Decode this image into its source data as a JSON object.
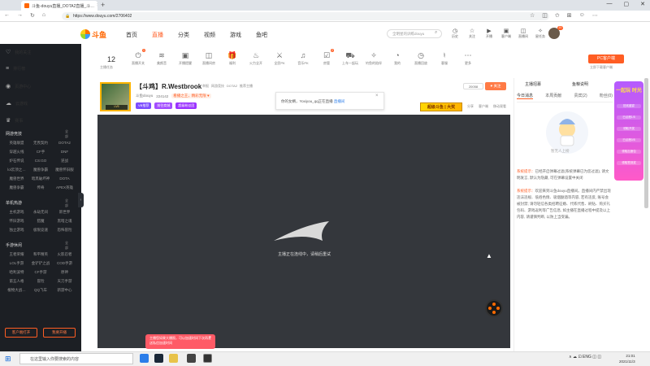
{
  "browser": {
    "tab_title": "斗鱼-douyu直播_DOTA2直播_斗…",
    "url": "https://www.douyu.com/2706402"
  },
  "site": {
    "logo_text": "斗鱼",
    "nav": [
      "首页",
      "直播",
      "分类",
      "视频",
      "游戏",
      "鱼吧"
    ],
    "nav_active": 1,
    "search_placeholder": "全明星的训练douyu",
    "header_icons": [
      "历史",
      "关注",
      "开播",
      "客户端",
      "直播间",
      "星任务"
    ],
    "avatar_badge": "20"
  },
  "sidebar": {
    "main": [
      {
        "label": "我的关注",
        "icon": "heart-icon"
      },
      {
        "label": "排行榜",
        "icon": "chart-icon"
      },
      {
        "label": "页游中心",
        "icon": "gamepad-icon"
      },
      {
        "label": "云游戏",
        "icon": "cloud-icon"
      },
      {
        "label": "赛事",
        "icon": "trophy-icon"
      }
    ],
    "sections": [
      {
        "title": "网游竞技",
        "more": "全部",
        "rows": [
          [
            "英雄联盟",
            "无畏契约",
            "DOTA2"
          ],
          [
            "穿越火线",
            "CF手",
            "DNF"
          ],
          [
            "炉石传说",
            "CS:GO",
            "逆战"
          ],
          [
            "lol云顶之…",
            "魔兽争霸",
            "魔兽怀旧服"
          ],
          [
            "魔兽世界",
            "暗黑破坏神",
            "DOTA"
          ],
          [
            "魔兽争霸",
            "传奇",
            "APEX英雄"
          ]
        ]
      },
      {
        "title": "单机热游",
        "more": "全部",
        "rows": [
          [
            "主机游戏",
            "永劫无间",
            "新世界"
          ],
          [
            "怀旧游戏",
            "猎魔",
            "黑暗之魂"
          ],
          [
            "独立游戏",
            "极限竞速",
            "恐怖冒险"
          ]
        ]
      },
      {
        "title": "手游休闲",
        "more": "全部",
        "rows": [
          [
            "王者荣耀",
            "和平精英",
            "火影忍者"
          ],
          [
            "LOL手游",
            "金铲铲之战",
            "COD手游"
          ],
          [
            "哈利波特",
            "CF手游",
            "原神"
          ],
          [
            "第五人格",
            "冒险",
            "天刀手游"
          ],
          [
            "植物大战…",
            "QQ飞车",
            "新游中心"
          ]
        ]
      }
    ],
    "btn_client": "客户端打开",
    "btn_live": "我要开播"
  },
  "toolbar": {
    "count": "12",
    "count_label": "主播任务",
    "items": [
      {
        "label": "直播开关",
        "glyph": "⏻",
        "badge": "1"
      },
      {
        "label": "美颜音",
        "glyph": "≋"
      },
      {
        "label": "开播提醒",
        "glyph": "▣"
      },
      {
        "label": "直播间房",
        "glyph": "◫"
      },
      {
        "label": "福利",
        "glyph": "🎁"
      },
      {
        "label": "火力全开",
        "glyph": "♨"
      },
      {
        "label": "全民PK",
        "glyph": "⚔"
      },
      {
        "label": "音乐PK",
        "glyph": "♫"
      },
      {
        "label": "房管",
        "glyph": "☑",
        "badge": "2"
      },
      {
        "label": "上车一起玩",
        "glyph": "⛟"
      },
      {
        "label": "钓鱼的陪伴",
        "glyph": "✧"
      },
      {
        "label": "我的",
        "glyph": "◔"
      },
      {
        "label": "直播回放",
        "glyph": "◷"
      },
      {
        "label": "客服",
        "glyph": "♮"
      },
      {
        "label": "更多",
        "glyph": "⋯"
      }
    ],
    "pc_button": "PC客户端",
    "pc_sub": "立即下载客户端"
  },
  "room": {
    "title": "【斗鸡】R.Westbrook",
    "level": "LV9",
    "category": [
      "举报",
      "网游竞技",
      "DOTA2",
      "推荐主播"
    ],
    "meta": [
      "斗鱼douyu",
      "224142",
      "看播之王，精彩无限 ♥"
    ],
    "hot": "♨",
    "tags": [
      {
        "text": "VB推荐",
        "color": "#7c4dff"
      },
      {
        "text": "前往商城",
        "color": "#a24cff"
      },
      {
        "text": "超级粉丝团",
        "color": "#9b33ff"
      }
    ],
    "notify": "你的女婿，Yoxiyou_qq正在直播",
    "notify_link": "直播间",
    "follow_count": "20058",
    "follow_label": "关注",
    "ad": "超级斗鱼 | 大奖",
    "links": [
      "分享",
      "客户端",
      "移动观看"
    ]
  },
  "player": {
    "status_text": "主播正在连线中，请稍后重试"
  },
  "toast": {
    "text": "主播您如果大爆照，可以加速时间下次再发送私信加速时间"
  },
  "rightpanel": {
    "header_left": "主播招募",
    "header_right": "鱼粮说明",
    "tabs": [
      "今日消息",
      "本周贡献",
      "贵宾(2)",
      "粉丝(0)"
    ],
    "empty_text": "暂无人上榜",
    "messages": [
      {
        "tag": "系统提示：",
        "text": "已经开启弹幕过滤(系统弹幕已为您过滤), 请文明发言, 默认为隐藏, 可在弹幕设置中关闭"
      },
      {
        "tag": "系统提示：",
        "text": "欢迎来到斗鱼douyu直播间。直播间内严禁出现违法违规、低俗色情、吸烟酗酒等内容, 若有违反, 账号会被封禁; 请勿轻信各类招聘征婚、代练代售、刷钻、购买礼包码、游戏返利等广告信息, 如主播在直播过程中提及以上内容, 请谨慎判断, 以防上当受骗。"
      }
    ]
  },
  "promo": {
    "title": "一起玩 时光",
    "items": [
      "狂欢盛宴",
      "已点燃1/5",
      "领取开奖",
      "已点燃0/5",
      "领取加速包",
      "领取签到奖"
    ]
  },
  "taskbar": {
    "search": "在这里输入你要搜索的内容",
    "tray": "∧  ☁  ⊡  ENG  ◫  ◫",
    "time": "21:01",
    "date": "2021/11/3"
  }
}
